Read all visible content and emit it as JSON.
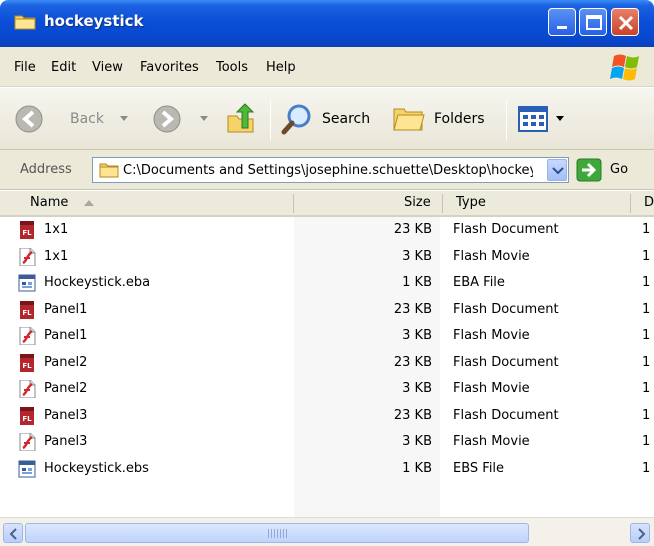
{
  "window": {
    "title": "hockeystick"
  },
  "menu": [
    "File",
    "Edit",
    "View",
    "Favorites",
    "Tools",
    "Help"
  ],
  "toolbar": {
    "back_label": "Back",
    "search_label": "Search",
    "folders_label": "Folders"
  },
  "address": {
    "label": "Address",
    "value": "C:\\Documents and Settings\\josephine.schuette\\Desktop\\hockeystick",
    "go_label": "Go"
  },
  "columns": {
    "name": "Name",
    "size": "Size",
    "type": "Type",
    "date": "D"
  },
  "files": [
    {
      "name": "1x1",
      "size": "23 KB",
      "type": "Flash Document",
      "date": "1",
      "icon": "fla-icon"
    },
    {
      "name": "1x1",
      "size": "3 KB",
      "type": "Flash Movie",
      "date": "1",
      "icon": "swf-icon"
    },
    {
      "name": "Hockeystick.eba",
      "size": "1 KB",
      "type": "EBA File",
      "date": "1",
      "icon": "generic-file-icon"
    },
    {
      "name": "Panel1",
      "size": "23 KB",
      "type": "Flash Document",
      "date": "1",
      "icon": "fla-icon"
    },
    {
      "name": "Panel1",
      "size": "3 KB",
      "type": "Flash Movie",
      "date": "1",
      "icon": "swf-icon"
    },
    {
      "name": "Panel2",
      "size": "23 KB",
      "type": "Flash Document",
      "date": "1",
      "icon": "fla-icon"
    },
    {
      "name": "Panel2",
      "size": "3 KB",
      "type": "Flash Movie",
      "date": "1",
      "icon": "swf-icon"
    },
    {
      "name": "Panel3",
      "size": "23 KB",
      "type": "Flash Document",
      "date": "1",
      "icon": "fla-icon"
    },
    {
      "name": "Panel3",
      "size": "3 KB",
      "type": "Flash Movie",
      "date": "1",
      "icon": "swf-icon"
    },
    {
      "name": "Hockeystick.ebs",
      "size": "1 KB",
      "type": "EBS File",
      "date": "1",
      "icon": "generic-file-icon"
    }
  ],
  "colors": {
    "titlebar": "#0a4fd6",
    "chrome": "#ece9d8",
    "flash_red": "#b3262d"
  }
}
